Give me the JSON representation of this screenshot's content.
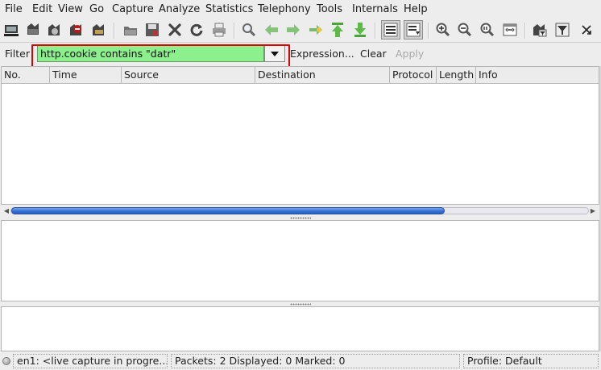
{
  "menu": [
    "File",
    "Edit",
    "View",
    "Go",
    "Capture",
    "Analyze",
    "Statistics",
    "Telephony",
    "Tools",
    "Internals",
    "Help"
  ],
  "toolbar": {
    "icons": [
      "interface-list-icon",
      "capture-options-icon",
      "start-capture-icon",
      "stop-capture-icon",
      "restart-capture-icon",
      "open-file-icon",
      "save-file-icon",
      "close-file-icon",
      "reload-icon",
      "print-icon",
      "find-packet-icon",
      "go-back-icon",
      "go-forward-icon",
      "go-to-packet-icon",
      "go-first-icon",
      "go-last-icon",
      "colorize-icon",
      "auto-scroll-icon",
      "zoom-in-icon",
      "zoom-out-icon",
      "zoom-normal-icon",
      "resize-columns-icon",
      "capture-filters-icon",
      "display-filters-icon",
      "more-icon"
    ]
  },
  "filter": {
    "label": "Filter",
    "value": "http.cookie contains \"datr\"",
    "expression_label": "Expression...",
    "clear_label": "Clear",
    "apply_label": "Apply",
    "highlight_color": "#e00000",
    "valid_color": "#8cf08c"
  },
  "packet_list": {
    "columns": [
      "No.",
      "Time",
      "Source",
      "Destination",
      "Protocol",
      "Length",
      "Info"
    ],
    "rows": []
  },
  "status": {
    "interface": "en1: <live capture in progre...",
    "packets": "Packets: 2 Displayed: 0 Marked: 0",
    "profile": "Profile: Default"
  }
}
